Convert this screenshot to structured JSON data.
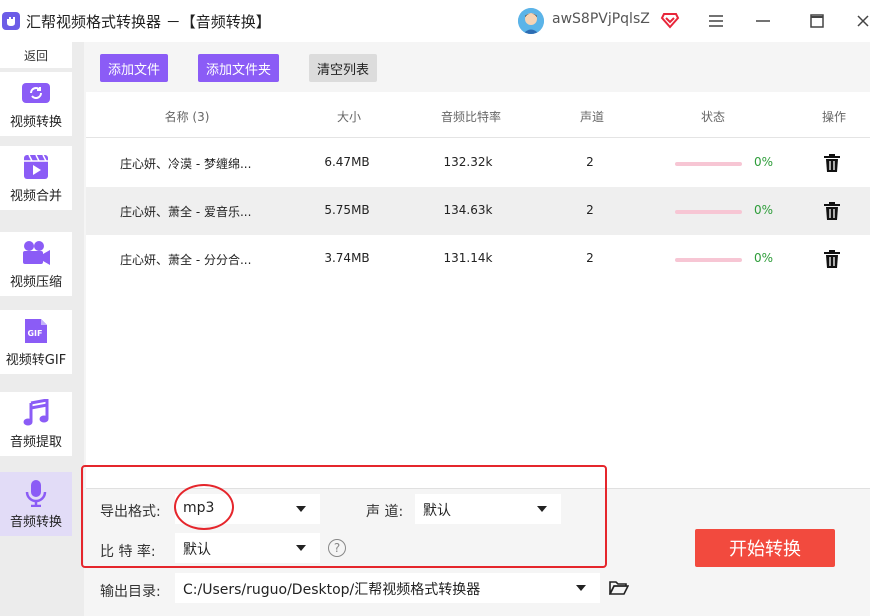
{
  "app": {
    "title": "汇帮视频格式转换器 －【音频转换】",
    "username": "awS8PVjPqlsZ"
  },
  "sidebar": {
    "back_label": "返回",
    "items": [
      {
        "label": "视频转换",
        "icon": "video-convert-icon"
      },
      {
        "label": "视频合并",
        "icon": "video-merge-icon"
      },
      {
        "label": "视频压缩",
        "icon": "video-compress-icon"
      },
      {
        "label": "视频转GIF",
        "icon": "gif-icon"
      },
      {
        "label": "音频提取",
        "icon": "music-note-icon"
      },
      {
        "label": "音频转换",
        "icon": "microphone-icon",
        "active": true
      }
    ]
  },
  "toolbar": {
    "add_file": "添加文件",
    "add_folder": "添加文件夹",
    "clear_list": "清空列表"
  },
  "table": {
    "headers": [
      "名称 (3)",
      "大小",
      "音频比特率",
      "声道",
      "状态",
      "操作"
    ],
    "rows": [
      {
        "name": "庄心妍、冷漠 - 梦缠绵...",
        "size": "6.47MB",
        "bitrate": "132.32k",
        "channels": "2",
        "progress": 0,
        "status": "0%"
      },
      {
        "name": "庄心妍、萧全 - 爱音乐...",
        "size": "5.75MB",
        "bitrate": "134.63k",
        "channels": "2",
        "progress": 0,
        "status": "0%"
      },
      {
        "name": "庄心妍、萧全 - 分分合...",
        "size": "3.74MB",
        "bitrate": "131.14k",
        "channels": "2",
        "progress": 0,
        "status": "0%"
      }
    ]
  },
  "settings": {
    "format_label": "导出格式:",
    "format_value": "mp3",
    "channel_label": "声 道:",
    "channel_value": "默认",
    "bitrate_label": "比 特 率:",
    "bitrate_value": "默认",
    "output_label": "输出目录:",
    "output_value": "C:/Users/ruguo/Desktop/汇帮视频格式转换器"
  },
  "start_button": "开始转换",
  "colors": {
    "accent": "#8b5cf6",
    "start": "#f24a3e",
    "annotation": "#e5262c",
    "progress_text": "#2e9d3a"
  }
}
